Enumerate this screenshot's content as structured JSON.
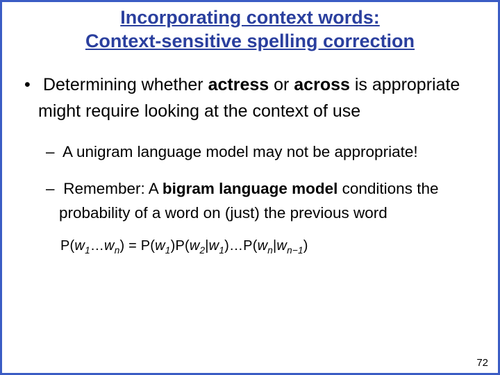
{
  "title_line1": "Incorporating context words:",
  "title_line2": "Context-sensitive spelling correction",
  "bullet_main": {
    "t1": "Determining whether ",
    "b1": "actress",
    "t2": " or ",
    "b2": "across",
    "t3": " is appropriate might require looking at the context of use"
  },
  "sub1": "A unigram language model may not be appropriate!",
  "sub2": {
    "t1": "Remember: A ",
    "b1": "bigram language model",
    "t2": " conditions the probability of a word on (just) the previous word"
  },
  "formula": {
    "lhs_P": "P(",
    "w": "w",
    "s1": "1",
    "ell": "…",
    "sn": "n",
    "rp": ")",
    "eq": " = ",
    "bar": "|",
    "s2": "2",
    "snm1": "n−1"
  },
  "page_number": "72"
}
